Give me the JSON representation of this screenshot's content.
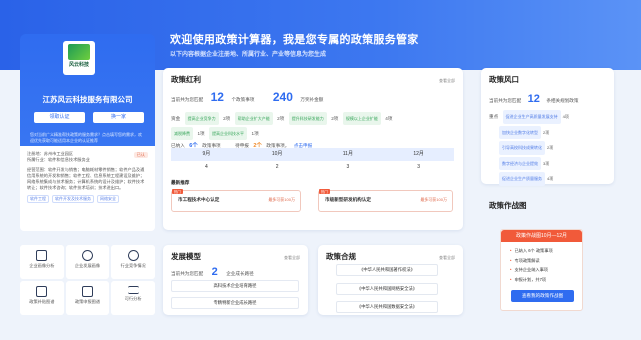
{
  "hero": {
    "title": "欢迎使用政策计算器，我是您专属的政策服务管家",
    "subtitle": "以下内容根据企业注册地、所属行业、产业等信息为您生成"
  },
  "company": {
    "logo_text": "风云科技",
    "name": "江苏风云科技服务有限公司",
    "btn_report": "领取认证",
    "btn_next": "换一家",
    "note": "您对当前广义精准帮扶政策的服务需求？点击填写您的需求，欢迎优先获取可能适用本企业的认证推荐",
    "register_label": "注册地：苏州市工业园区",
    "industry_label": "所属行业：软件和信息技术服务业",
    "tag": "已认",
    "desc": "经营范围：软件开发与销售；电脑耗材零件销售；软件产品及通信用系统的开发和销售；软件工程、信息系统工程建设及维护；网络系统集成与技术服务；计算机系统的设计及维护；软件技术转让；软件技术咨询；软件技术培训；技术进出口。",
    "tags": [
      "软件工程",
      "软件开发及技术服务",
      "网络安全"
    ]
  },
  "tiles": [
    {
      "label": "企业画像分析",
      "icon": "building-icon"
    },
    {
      "label": "企业发展画像",
      "icon": "globe-icon"
    },
    {
      "label": "行业竞争情况",
      "icon": "chart-icon"
    },
    {
      "label": "政策补贴图谱",
      "icon": "book-icon"
    },
    {
      "label": "政策申报图谱",
      "icon": "map-icon"
    },
    {
      "label": "可行分析",
      "icon": "menu-icon"
    }
  ],
  "dividend": {
    "title": "政策红利",
    "more": "查看全部",
    "match_label": "当前共为您匹配",
    "match_count": "12",
    "match_unit": "个政策事项",
    "amount": "240",
    "amount_unit": "万奖补金额",
    "type_label": "资金",
    "chips": [
      {
        "text": "提高企业竞争力",
        "n": "2项"
      },
      {
        "text": "帮助企业扩大产能",
        "n": "2项"
      },
      {
        "text": "提升科技研发能力",
        "n": "2项"
      },
      {
        "text": "规模以上企业扩能",
        "n": "4项"
      },
      {
        "text": "减税降费",
        "n": "1项"
      },
      {
        "text": "提高企业科技水平",
        "n": "1项"
      }
    ],
    "done_label": "已纳入",
    "done_count": "6个",
    "done_unit": "政策事项",
    "pending_label": "待申报",
    "pending_count": "2个",
    "pending_unit": "政策事项，",
    "pending_link": "点击申报",
    "months": [
      "9月",
      "10月",
      "11月",
      "12月"
    ],
    "month_values": [
      "4",
      "2",
      "3",
      "3"
    ],
    "recommend_title": "最新推荐",
    "rec": [
      {
        "tag": "热门",
        "name": "市工程技术中心认定",
        "reward": "最多可获100万"
      },
      {
        "tag": "热门",
        "name": "市级新型研发机构认定",
        "reward": "最多可获100万"
      }
    ]
  },
  "risk": {
    "title": "政策风口",
    "match_label": "当前共为您匹配",
    "match_count": "12",
    "match_unit": "条相关规划政策",
    "tag_label": "重点",
    "items": [
      {
        "text": "促进企业生产高质量发展支持",
        "n": "4项"
      },
      {
        "text": "加快企业数字化转型",
        "n": "2项"
      },
      {
        "text": "引导高校科技成果转化",
        "n": "2项"
      },
      {
        "text": "数字经济与企业提效",
        "n": "3项"
      },
      {
        "text": "促进企业生产质量服务",
        "n": "4项"
      }
    ]
  },
  "calendar": {
    "section_title": "政策作战图",
    "head": "政策作战图10月—12月",
    "lines": [
      "已纳入 6个 政策事项",
      "专项政策解读",
      "支持企业纳入事项",
      "申报计划，共7项"
    ],
    "button": "查看我的政策作战图"
  },
  "model": {
    "title": "发展模型",
    "more": "查看全部",
    "match_label": "当前共为您匹配",
    "count": "2",
    "unit": "企业成长路径",
    "items": [
      "高科技术企业培育路径",
      "专精特新企业成长路径"
    ]
  },
  "compliance": {
    "title": "政策合规",
    "more": "查看全部",
    "items": [
      "《中华人民共和国著作权法》",
      "《中华人民共和国网络安全法》",
      "《中华人民共和国数据安全法》"
    ]
  }
}
